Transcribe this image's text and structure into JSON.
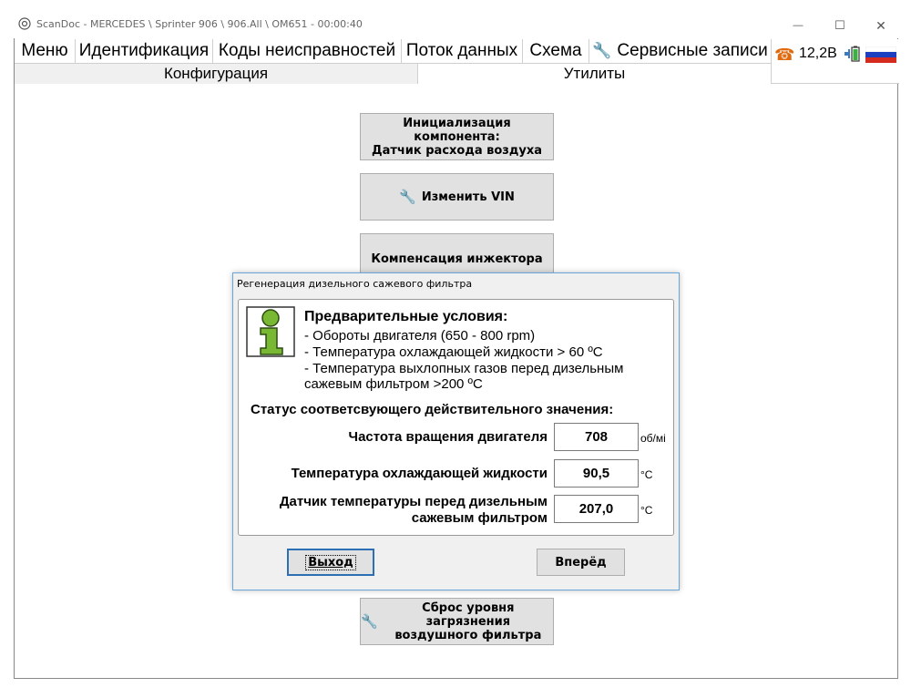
{
  "window": {
    "title": "ScanDoc - MERCEDES \\ Sprinter 906 \\ 906.All \\ OM651 - 00:00:40",
    "controls": {
      "minimize": "—",
      "maximize": "☐",
      "close": "✕"
    }
  },
  "menu": {
    "items": [
      "Меню",
      "Идентификация",
      "Коды неисправностей",
      "Поток данных",
      "Схема",
      "Сервисные записи"
    ]
  },
  "status": {
    "voltage": "12,2В",
    "icons": [
      "phone-icon",
      "plug-icon",
      "battery-icon",
      "russia-flag"
    ]
  },
  "subtabs": {
    "config": "Конфигурация",
    "utils": "Утилиты",
    "active": "utils"
  },
  "buttons": {
    "init_line1": "Инициализация компонента:",
    "init_line2": "Датчик расхода воздуха",
    "change_vin": "Изменить VIN",
    "injector": "Компенсация инжектора",
    "reset_line1": "Сброс уровня загрязнения",
    "reset_line2": "воздушного фильтра"
  },
  "dialog": {
    "title": "Регенерация дизельного сажевого фильтра",
    "pre_heading": "Предварительные условия:",
    "pre_lines": [
      "- Обороты двигателя (650 - 800 rpm)",
      "- Температура охлаждающей жидкости > 60 ºC",
      "- Температура выхлопных газов перед дизельным",
      "сажевым фильтром >200 ºC"
    ],
    "status_heading": "Статус соответсвующего действительного значения:",
    "params": [
      {
        "label": "Частота вращения двигателя",
        "value": "708",
        "unit": "об/мі"
      },
      {
        "label": "Температура охлаждающей жидкости",
        "value": "90,5",
        "unit": "°C"
      },
      {
        "label_line1": "Датчик температуры перед дизельным",
        "label_line2": "сажевым фильтром",
        "value": "207,0",
        "unit": "°C"
      }
    ],
    "exit_label": "Выход",
    "next_label": "Вперёд"
  },
  "colors": {
    "accent": "#2c6fb5",
    "icon_green": "#78b833",
    "phone": "#e06a10"
  }
}
